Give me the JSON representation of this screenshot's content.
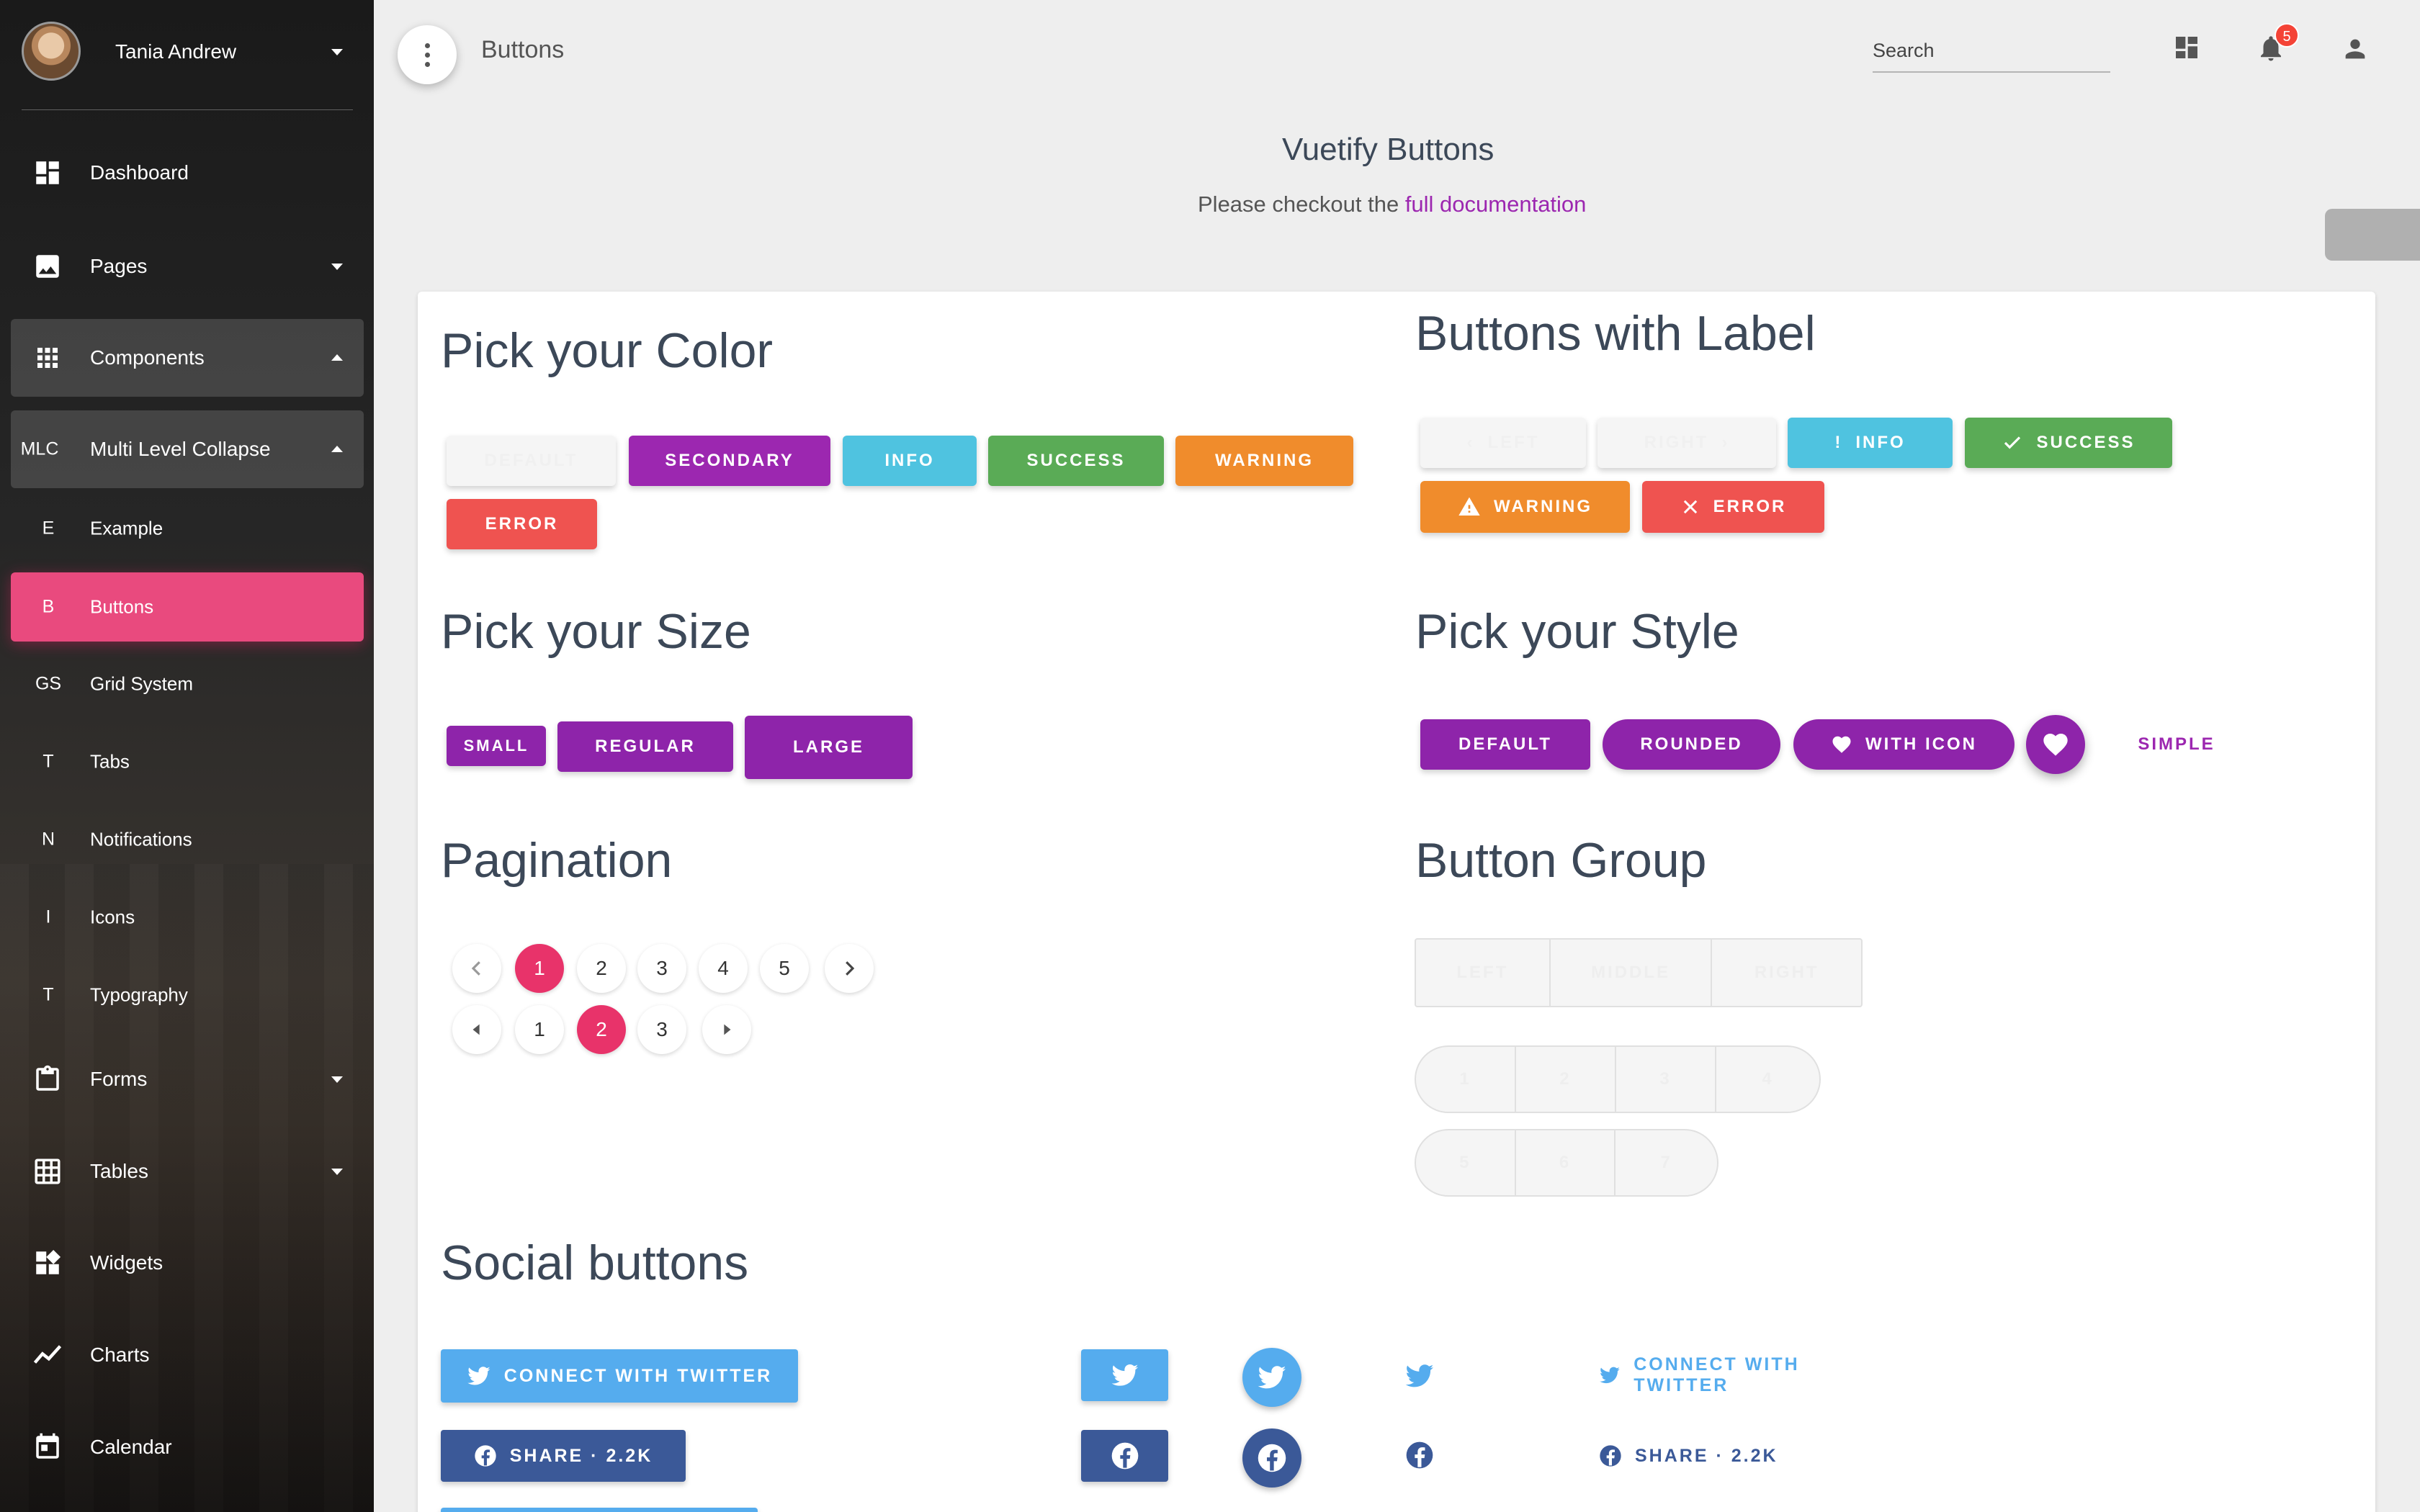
{
  "sidebar": {
    "user_name": "Tania Andrew",
    "items": [
      {
        "label": "Dashboard"
      },
      {
        "label": "Pages"
      },
      {
        "label": "Components"
      },
      {
        "label": "Multi Level Collapse",
        "abbr": "MLC"
      },
      {
        "label": "Example",
        "abbr": "E"
      },
      {
        "label": "Buttons",
        "abbr": "B"
      },
      {
        "label": "Grid System",
        "abbr": "GS"
      },
      {
        "label": "Tabs",
        "abbr": "T"
      },
      {
        "label": "Notifications",
        "abbr": "N"
      },
      {
        "label": "Icons",
        "abbr": "I"
      },
      {
        "label": "Typography",
        "abbr": "T"
      },
      {
        "label": "Forms"
      },
      {
        "label": "Tables"
      },
      {
        "label": "Widgets"
      },
      {
        "label": "Charts"
      },
      {
        "label": "Calendar"
      }
    ],
    "active_color": "#e94a7e"
  },
  "topbar": {
    "page_title": "Buttons",
    "search_placeholder": "Search",
    "notification_count": "5"
  },
  "header": {
    "title": "Vuetify Buttons",
    "subtitle_prefix": "Please checkout the",
    "subtitle_link": "full documentation"
  },
  "colors_section": {
    "title": "Pick your Color",
    "buttons": [
      "Default",
      "Secondary",
      "Info",
      "Success",
      "Warning",
      "Error"
    ]
  },
  "label_section": {
    "title": "Buttons with Label",
    "buttons": [
      "Left",
      "Right",
      "Info",
      "Success",
      "Warning",
      "Error"
    ]
  },
  "size_section": {
    "title": "Pick your Size",
    "buttons": [
      "Small",
      "Regular",
      "Large"
    ]
  },
  "style_section": {
    "title": "Pick your Style",
    "buttons": [
      "Default",
      "Rounded",
      "With Icon",
      "Simple"
    ]
  },
  "pagination_section": {
    "title": "Pagination",
    "row1": [
      "1",
      "2",
      "3",
      "4",
      "5"
    ],
    "row1_active": "1",
    "row2": [
      "1",
      "2",
      "3"
    ],
    "row2_active": "2"
  },
  "group_section": {
    "title": "Button Group",
    "group1": [
      "Left",
      "Middle",
      "Right"
    ],
    "group2": [
      "1",
      "2",
      "3",
      "4"
    ],
    "group3": [
      "5",
      "6",
      "7"
    ]
  },
  "social_section": {
    "title": "Social buttons",
    "twitter_label": "Connect with Twitter",
    "facebook_label": "Share · 2.2k",
    "twitter_color": "#55acee",
    "facebook_color": "#3b5998"
  },
  "accent_colors": {
    "primary": "#9c27b0",
    "pagination_active": "#e8336a"
  }
}
